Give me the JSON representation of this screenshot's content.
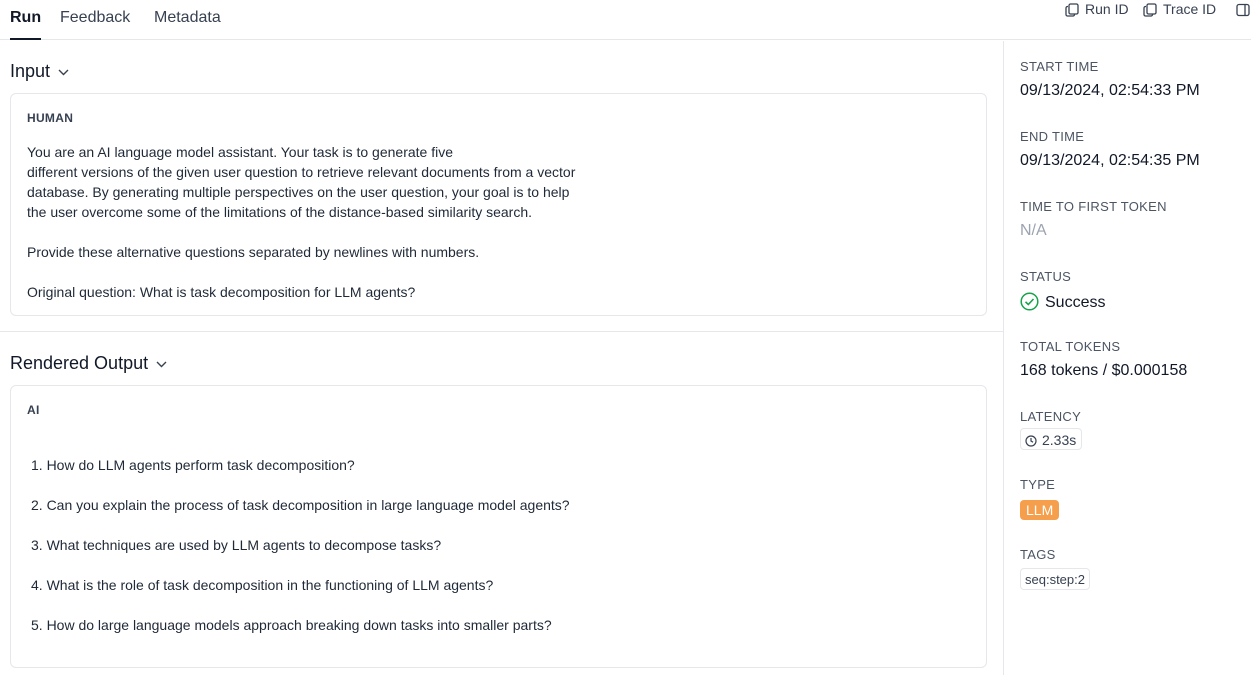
{
  "tabs": [
    {
      "label": "Run",
      "active": true
    },
    {
      "label": "Feedback",
      "active": false
    },
    {
      "label": "Metadata",
      "active": false
    }
  ],
  "top_actions": {
    "run_id": "Run ID",
    "trace_id": "Trace ID"
  },
  "input": {
    "title": "Input",
    "role": "HUMAN",
    "lines": [
      "You are an AI language model assistant. Your task is to generate five",
      "different versions of the given user question to retrieve relevant documents from a vector",
      "database. By generating multiple perspectives on the user question, your goal is to help",
      "the user overcome some of the limitations of the distance-based similarity search.",
      "Provide these alternative questions separated by newlines with numbers.",
      "Original question: What is task decomposition for LLM agents?"
    ]
  },
  "output": {
    "title": "Rendered Output",
    "role": "AI",
    "items": [
      "1. How do LLM agents perform task decomposition?",
      "2. Can you explain the process of task decomposition in large language model agents?",
      "3. What techniques are used by LLM agents to decompose tasks?",
      "4. What is the role of task decomposition in the functioning of LLM agents?",
      "5. How do large language models approach breaking down tasks into smaller parts?"
    ]
  },
  "meta": {
    "start_time_label": "START TIME",
    "start_time": "09/13/2024, 02:54:33 PM",
    "end_time_label": "END TIME",
    "end_time": "09/13/2024, 02:54:35 PM",
    "ttft_label": "TIME TO FIRST TOKEN",
    "ttft": "N/A",
    "status_label": "STATUS",
    "status": "Success",
    "total_tokens_label": "TOTAL TOKENS",
    "total_tokens": "168 tokens / $0.000158",
    "latency_label": "LATENCY",
    "latency": "2.33s",
    "type_label": "TYPE",
    "type": "LLM",
    "tags_label": "TAGS",
    "tag": "seq:step:2"
  },
  "colors": {
    "success": "#16a34a",
    "type_badge": "#f59e4b",
    "border": "#e5e7eb"
  },
  "icons": {
    "copy": "copy-icon",
    "panel": "panel-toggle-icon",
    "chevron": "chevron-down-icon",
    "status": "check-circle-icon",
    "latency": "clock-icon"
  }
}
